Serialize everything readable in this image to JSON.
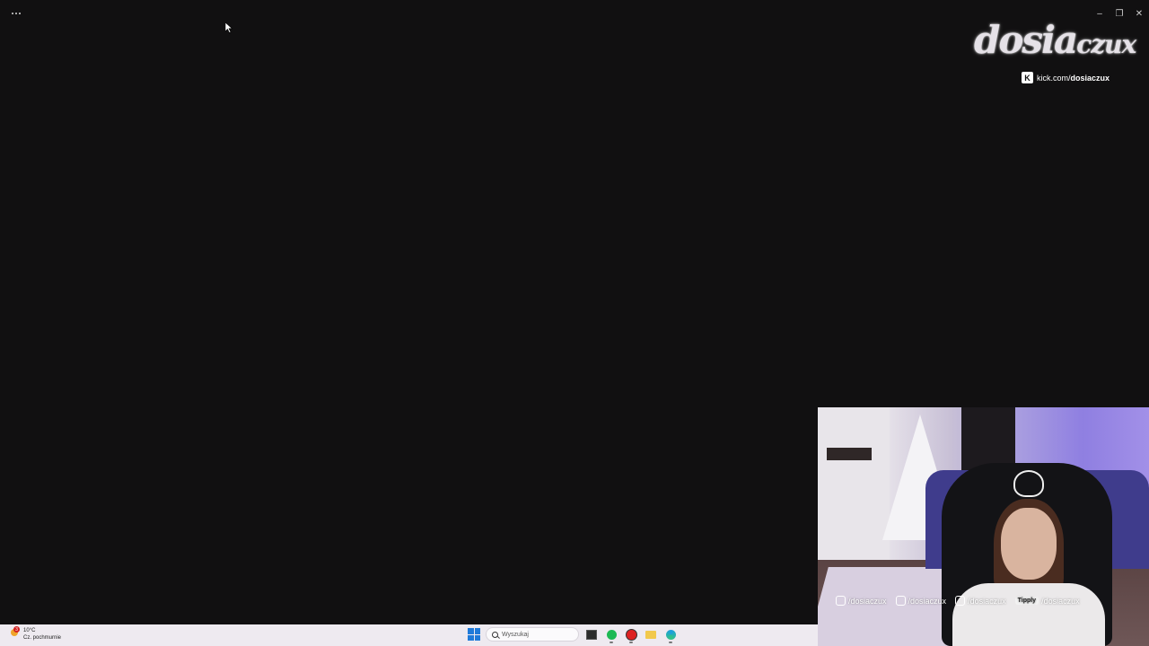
{
  "window": {
    "menu_icon": "more-horizontal-icon",
    "controls": {
      "minimize_icon": "minimize-icon",
      "minimize_glyph": "–",
      "restore_icon": "restore-icon",
      "restore_glyph": "❐",
      "close_icon": "close-icon",
      "close_glyph": "✕"
    }
  },
  "overlay": {
    "logo_main": "dosia",
    "logo_small": "czux",
    "kick_icon_letter": "K",
    "kick_url_prefix": "kick.com/",
    "kick_url_handle": "dosiaczux"
  },
  "webcam": {
    "socials": [
      {
        "icon": "instagram-icon",
        "handle": "/dosiaczux"
      },
      {
        "icon": "tiktok-icon",
        "handle": "/dosiaczux"
      },
      {
        "icon": "youtube-icon",
        "handle": "/dosiaczux"
      }
    ],
    "tipply_label": "Tipply",
    "tipply_handle": "/dosiaczux"
  },
  "taskbar": {
    "weather": {
      "temp": "10°C",
      "condition": "Cz. pochmurnie",
      "badge": "3"
    },
    "search_placeholder": "Wyszukaj",
    "apps": [
      {
        "name": "file-explorer-icon"
      },
      {
        "name": "spotify-icon"
      },
      {
        "name": "app-icon"
      },
      {
        "name": "folder-icon"
      },
      {
        "name": "edge-icon"
      }
    ]
  },
  "colors": {
    "background": "#111011",
    "taskbar": "#eeeaf0",
    "accent_blue": "#1f7ad9"
  }
}
